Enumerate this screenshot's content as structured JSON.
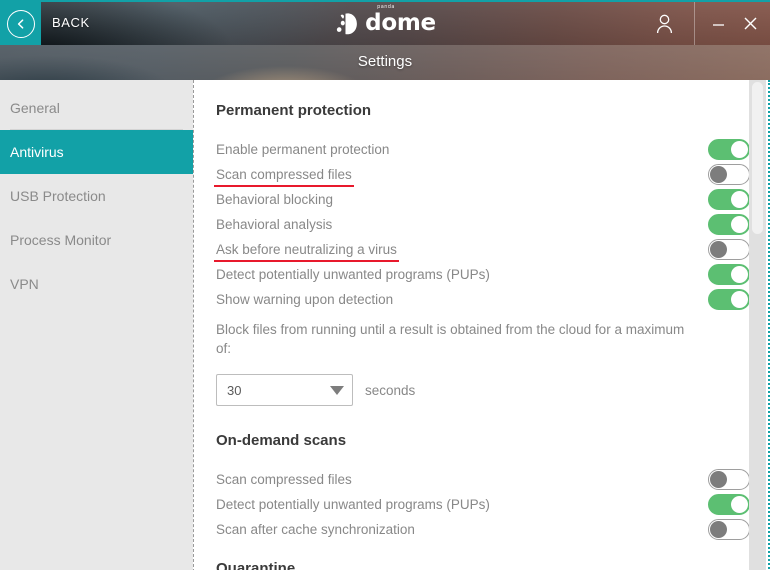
{
  "window": {
    "back_label": "BACK",
    "back_icon": "chevron-left-icon",
    "logo_sup": "panda",
    "logo_word": "dome",
    "user_icon": "user-account-icon",
    "minimize_icon": "minimize-icon",
    "close_icon": "close-icon",
    "accent_teal": "#12a1a7"
  },
  "subheader": {
    "title": "Settings"
  },
  "sidebar": {
    "items": [
      {
        "label": "General",
        "active": false
      },
      {
        "label": "Antivirus",
        "active": true
      },
      {
        "label": "USB Protection",
        "active": false
      },
      {
        "label": "Process Monitor",
        "active": false
      },
      {
        "label": "VPN",
        "active": false
      }
    ]
  },
  "main": {
    "permanent_protection": {
      "title": "Permanent protection",
      "rows": [
        {
          "label": "Enable permanent protection",
          "state": "on",
          "marked": false
        },
        {
          "label": "Scan compressed files",
          "state": "off",
          "marked": true
        },
        {
          "label": "Behavioral blocking",
          "state": "on",
          "marked": false
        },
        {
          "label": "Behavioral analysis",
          "state": "on",
          "marked": false
        },
        {
          "label": "Ask before neutralizing a virus",
          "state": "off",
          "marked": true
        },
        {
          "label": "Detect potentially unwanted programs (PUPs)",
          "state": "on",
          "marked": false
        },
        {
          "label": "Show warning upon detection",
          "state": "on",
          "marked": false
        }
      ],
      "block_text": "Block files from running until a result is obtained from the cloud for a maximum of:",
      "timeout_value": "30",
      "timeout_unit": "seconds",
      "timeout_options": [
        "30"
      ]
    },
    "on_demand_scans": {
      "title": "On-demand scans",
      "rows": [
        {
          "label": "Scan compressed files",
          "state": "off",
          "marked": false
        },
        {
          "label": "Detect potentially unwanted programs (PUPs)",
          "state": "on",
          "marked": false
        },
        {
          "label": "Scan after cache synchronization",
          "state": "off",
          "marked": false
        }
      ]
    },
    "quarantine": {
      "title": "Quarantine"
    }
  },
  "colors": {
    "toggle_on": "#5cbf72",
    "toggle_off_knob": "#7d7d7d",
    "annotation_red": "#e8192c",
    "sidebar_bg": "#e8e8e8"
  }
}
